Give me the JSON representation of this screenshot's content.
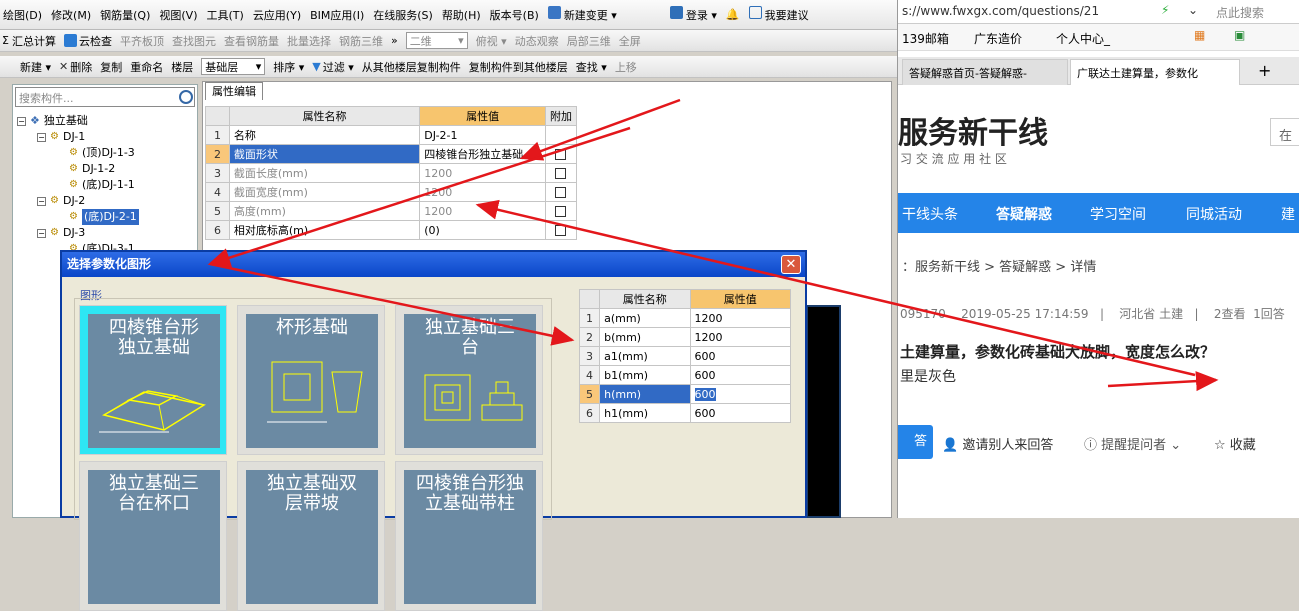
{
  "app": {
    "menu": [
      "绘图(D)",
      "修改(M)",
      "钢筋量(Q)",
      "视图(V)",
      "工具(T)",
      "云应用(Y)",
      "BIM应用(I)",
      "在线服务(S)",
      "帮助(H)",
      "版本号(B)",
      "新建变更 ▾",
      "登录 ▾",
      "我要建议"
    ],
    "toolbar1": {
      "sigma": "Σ",
      "items": [
        "汇总计算",
        "云检查",
        "平齐板顶",
        "查找图元",
        "查看钢筋量",
        "批量选择",
        "钢筋三维"
      ],
      "view_combo": "二维",
      "items2": [
        "俯视 ▾",
        "动态观察",
        "局部三维",
        "全屏"
      ]
    },
    "toolbar2": {
      "items": [
        "新建 ▾",
        "删除",
        "复制",
        "重命名",
        "楼层"
      ],
      "floor_combo": "基础层",
      "items2": [
        "排序 ▾",
        "过滤 ▾",
        "从其他楼层复制构件",
        "复制构件到其他楼层",
        "查找 ▾",
        "上移"
      ]
    },
    "search_placeholder": "搜索构件...",
    "tree": [
      {
        "label": "独立基础",
        "level": 0,
        "expander": "−"
      },
      {
        "label": "DJ-1",
        "level": 1,
        "expander": "−"
      },
      {
        "label": "(顶)DJ-1-3",
        "level": 2
      },
      {
        "label": "DJ-1-2",
        "level": 2
      },
      {
        "label": "(底)DJ-1-1",
        "level": 2
      },
      {
        "label": "DJ-2",
        "level": 1,
        "expander": "−"
      },
      {
        "label": "(底)DJ-2-1",
        "level": 2,
        "selected": true
      },
      {
        "label": "DJ-3",
        "level": 1,
        "expander": "−"
      },
      {
        "label": "(底)DJ-3-1",
        "level": 2
      }
    ],
    "property_tab": "属性编辑",
    "property_table": {
      "headers": [
        "属性名称",
        "属性值",
        "附加"
      ],
      "rows": [
        {
          "n": "1",
          "name": "名称",
          "value": "DJ-2-1",
          "check": false,
          "gray": false
        },
        {
          "n": "2",
          "name": "截面形状",
          "value": "四棱锥台形独立基础",
          "check": true,
          "gray": false,
          "selected": true
        },
        {
          "n": "3",
          "name": "截面长度(mm)",
          "value": "1200",
          "check": true,
          "gray": true
        },
        {
          "n": "4",
          "name": "截面宽度(mm)",
          "value": "1200",
          "check": true,
          "gray": true
        },
        {
          "n": "5",
          "name": "高度(mm)",
          "value": "1200",
          "check": true,
          "gray": true
        },
        {
          "n": "6",
          "name": "相对底标高(m)",
          "value": "(0)",
          "check": true,
          "gray": false
        }
      ]
    }
  },
  "dialog": {
    "title": "选择参数化图形",
    "close": "✕",
    "group_label": "图形",
    "shapes": [
      {
        "label": "四棱锥台形独立基础",
        "selected": true
      },
      {
        "label": "杯形基础",
        "selected": false
      },
      {
        "label": "独立基础三台",
        "selected": false
      },
      {
        "label": "独立基础三台在杯口",
        "selected": false
      },
      {
        "label": "独立基础双层带坡",
        "selected": false
      },
      {
        "label": "四棱锥台形独立基础带柱",
        "selected": false
      }
    ],
    "param_table": {
      "headers": [
        "属性名称",
        "属性值"
      ],
      "rows": [
        {
          "n": "1",
          "name": "a(mm)",
          "value": "1200"
        },
        {
          "n": "2",
          "name": "b(mm)",
          "value": "1200"
        },
        {
          "n": "3",
          "name": "a1(mm)",
          "value": "600"
        },
        {
          "n": "4",
          "name": "b1(mm)",
          "value": "600"
        },
        {
          "n": "5",
          "name": "h(mm)",
          "value": "600",
          "selected": true
        },
        {
          "n": "6",
          "name": "h1(mm)",
          "value": "600"
        }
      ]
    }
  },
  "browser": {
    "url": "s://www.fwxgx.com/questions/21",
    "search_hint": "点此搜索",
    "favorites": [
      "139邮箱",
      "广东造价",
      "个人中心_"
    ],
    "tabs": [
      "答疑解惑首页-答疑解惑-",
      "广联达土建算量，参数化"
    ],
    "site_name": "服务新干线",
    "site_slogan": "习 交 流 应 用 社 区",
    "site_btn": "在",
    "nav": [
      "干线头条",
      "答疑解惑",
      "学习空间",
      "同城活动",
      "建"
    ],
    "breadcrumb": "：服务新干线 > 答疑解惑 > 详情",
    "meta": {
      "user": "095170",
      "date": "2019-05-25 17:14:59",
      "region": "河北省 土建",
      "views": "2查看",
      "answers": "1回答"
    },
    "question": "土建算量，参数化砖基础大放脚，宽度怎么改？",
    "detail": "里是灰色",
    "answer_btn": "答",
    "actions": [
      "邀请别人来回答",
      "提醒提问者",
      "收藏"
    ]
  }
}
